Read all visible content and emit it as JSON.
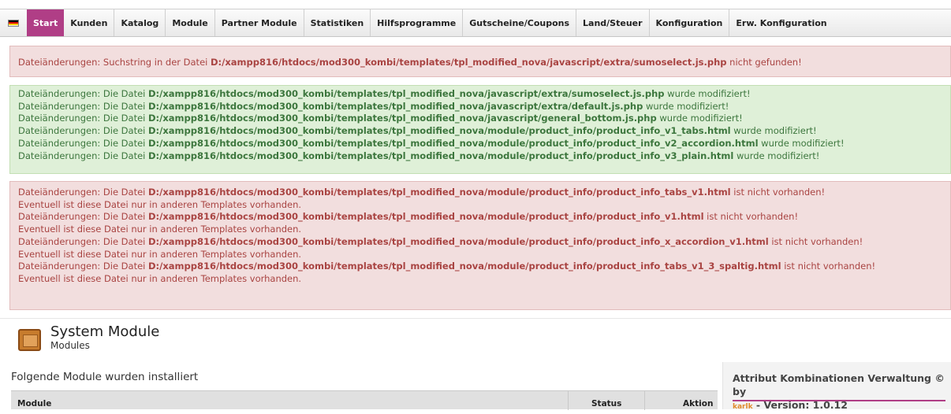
{
  "nav": {
    "flag_colors": [
      "#000000",
      "#dd0000",
      "#ffce00"
    ],
    "items": [
      {
        "label": "Start",
        "active": true
      },
      {
        "label": "Kunden"
      },
      {
        "label": "Katalog"
      },
      {
        "label": "Module"
      },
      {
        "label": "Partner Module"
      },
      {
        "label": "Statistiken"
      },
      {
        "label": "Hilfsprogramme"
      },
      {
        "label": "Gutscheine/Coupons"
      },
      {
        "label": "Land/Steuer"
      },
      {
        "label": "Konfiguration"
      },
      {
        "label": "Erw. Konfiguration"
      }
    ]
  },
  "messages": {
    "error_search": {
      "prefix": "Dateiänderungen: Suchstring in der Datei ",
      "path": "D:/xampp816/htdocs/mod300_kombi/templates/tpl_modified_nova/javascript/extra/sumoselect.js.php",
      "suffix": " nicht gefunden!"
    },
    "success": [
      {
        "prefix": "Dateiänderungen: Die Datei ",
        "path": "D:/xampp816/htdocs/mod300_kombi/templates/tpl_modified_nova/javascript/extra/sumoselect.js.php",
        "suffix": " wurde modifiziert!"
      },
      {
        "prefix": "Dateiänderungen: Die Datei ",
        "path": "D:/xampp816/htdocs/mod300_kombi/templates/tpl_modified_nova/javascript/extra/default.js.php",
        "suffix": " wurde modifiziert!"
      },
      {
        "prefix": "Dateiänderungen: Die Datei ",
        "path": "D:/xampp816/htdocs/mod300_kombi/templates/tpl_modified_nova/javascript/general_bottom.js.php",
        "suffix": " wurde modifiziert!"
      },
      {
        "prefix": "Dateiänderungen: Die Datei ",
        "path": "D:/xampp816/htdocs/mod300_kombi/templates/tpl_modified_nova/module/product_info/product_info_v1_tabs.html",
        "suffix": " wurde modifiziert!"
      },
      {
        "prefix": "Dateiänderungen: Die Datei ",
        "path": "D:/xampp816/htdocs/mod300_kombi/templates/tpl_modified_nova/module/product_info/product_info_v2_accordion.html",
        "suffix": " wurde modifiziert!"
      },
      {
        "prefix": "Dateiänderungen: Die Datei ",
        "path": "D:/xampp816/htdocs/mod300_kombi/templates/tpl_modified_nova/module/product_info/product_info_v3_plain.html",
        "suffix": " wurde modifiziert!"
      }
    ],
    "missing": [
      {
        "prefix": "Dateiänderungen: Die Datei ",
        "path": "D:/xampp816/htdocs/mod300_kombi/templates/tpl_modified_nova/module/product_info/product_info_tabs_v1.html",
        "suffix": " ist nicht vorhanden!",
        "note": "Eventuell ist diese Datei nur in anderen Templates vorhanden."
      },
      {
        "prefix": "Dateiänderungen: Die Datei ",
        "path": "D:/xampp816/htdocs/mod300_kombi/templates/tpl_modified_nova/module/product_info/product_info_v1.html",
        "suffix": " ist nicht vorhanden!",
        "note": "Eventuell ist diese Datei nur in anderen Templates vorhanden."
      },
      {
        "prefix": "Dateiänderungen: Die Datei ",
        "path": "D:/xampp816/htdocs/mod300_kombi/templates/tpl_modified_nova/module/product_info/product_info_x_accordion_v1.html",
        "suffix": " ist nicht vorhanden!",
        "note": "Eventuell ist diese Datei nur in anderen Templates vorhanden."
      },
      {
        "prefix": "Dateiänderungen: Die Datei ",
        "path": "D:/xampp816/htdocs/mod300_kombi/templates/tpl_modified_nova/module/product_info/product_info_tabs_v1_3_spaltig.html",
        "suffix": " ist nicht vorhanden!",
        "note": "Eventuell ist diese Datei nur in anderen Templates vorhanden."
      }
    ]
  },
  "module_section": {
    "title": "System Module",
    "subtitle": "Modules",
    "installed_label": "Folgende Module wurden installiert",
    "columns": {
      "module": "Module",
      "status": "Status",
      "action": "Aktion"
    }
  },
  "side_box": {
    "title": "Attribut Kombinationen Verwaltung © by",
    "author": "karlk",
    "version": " - Version: 1.0.12"
  },
  "colors": {
    "accent": "#b03e86",
    "error_bg": "#f2dede",
    "error_text": "#a94442",
    "success_bg": "#dff0d8",
    "success_text": "#3c763d"
  }
}
